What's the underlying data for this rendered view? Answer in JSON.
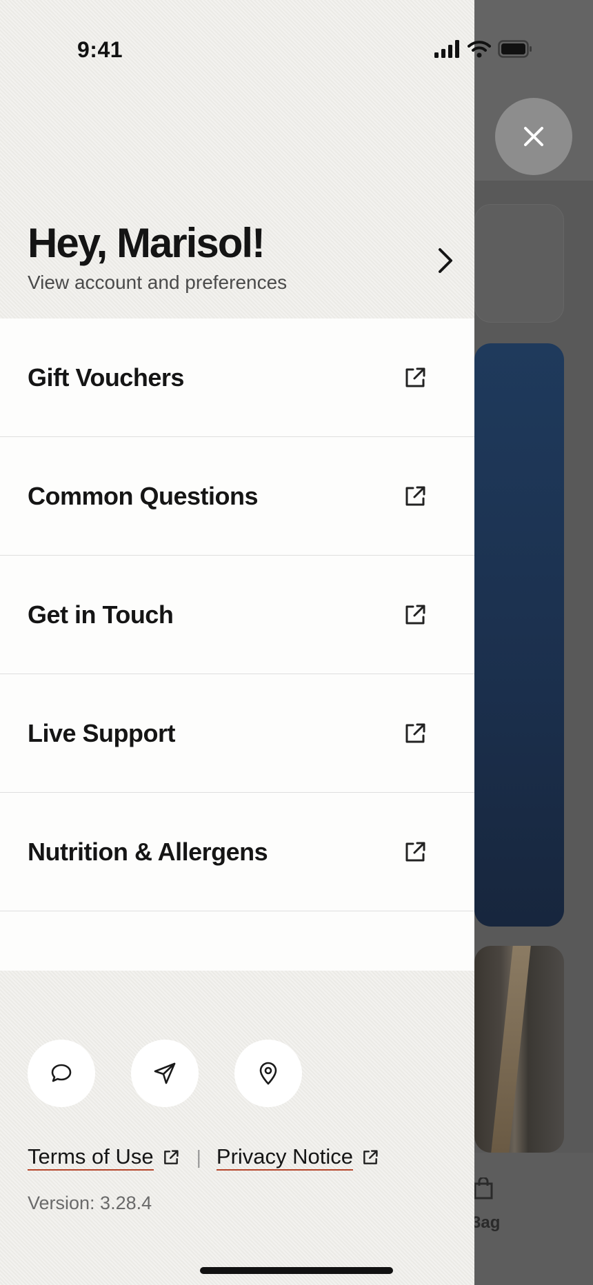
{
  "status_bar": {
    "time": "9:41"
  },
  "header": {
    "greeting": "Hey, Marisol!",
    "subtitle": "View account and preferences"
  },
  "menu": {
    "items": [
      {
        "label": "Gift Vouchers",
        "icon": "external-link-icon"
      },
      {
        "label": "Common Questions",
        "icon": "external-link-icon"
      },
      {
        "label": "Get in Touch",
        "icon": "external-link-icon"
      },
      {
        "label": "Live Support",
        "icon": "external-link-icon"
      },
      {
        "label": "Nutrition & Allergens",
        "icon": "external-link-icon"
      }
    ]
  },
  "quick_actions": [
    {
      "icon": "chat-bubble-icon"
    },
    {
      "icon": "send-icon"
    },
    {
      "icon": "location-pin-icon"
    }
  ],
  "footer": {
    "terms_label": "Terms of Use",
    "privacy_label": "Privacy Notice",
    "separator": "|",
    "version": "Version: 3.28.4"
  },
  "background": {
    "tab_label_partial": "3ag"
  },
  "colors": {
    "drawer_bg": "#efeeea",
    "menu_bg": "#fdfdfc",
    "link_underline": "#b5452a",
    "promo_card": "#1f3a5c",
    "overlay": "#595959"
  }
}
